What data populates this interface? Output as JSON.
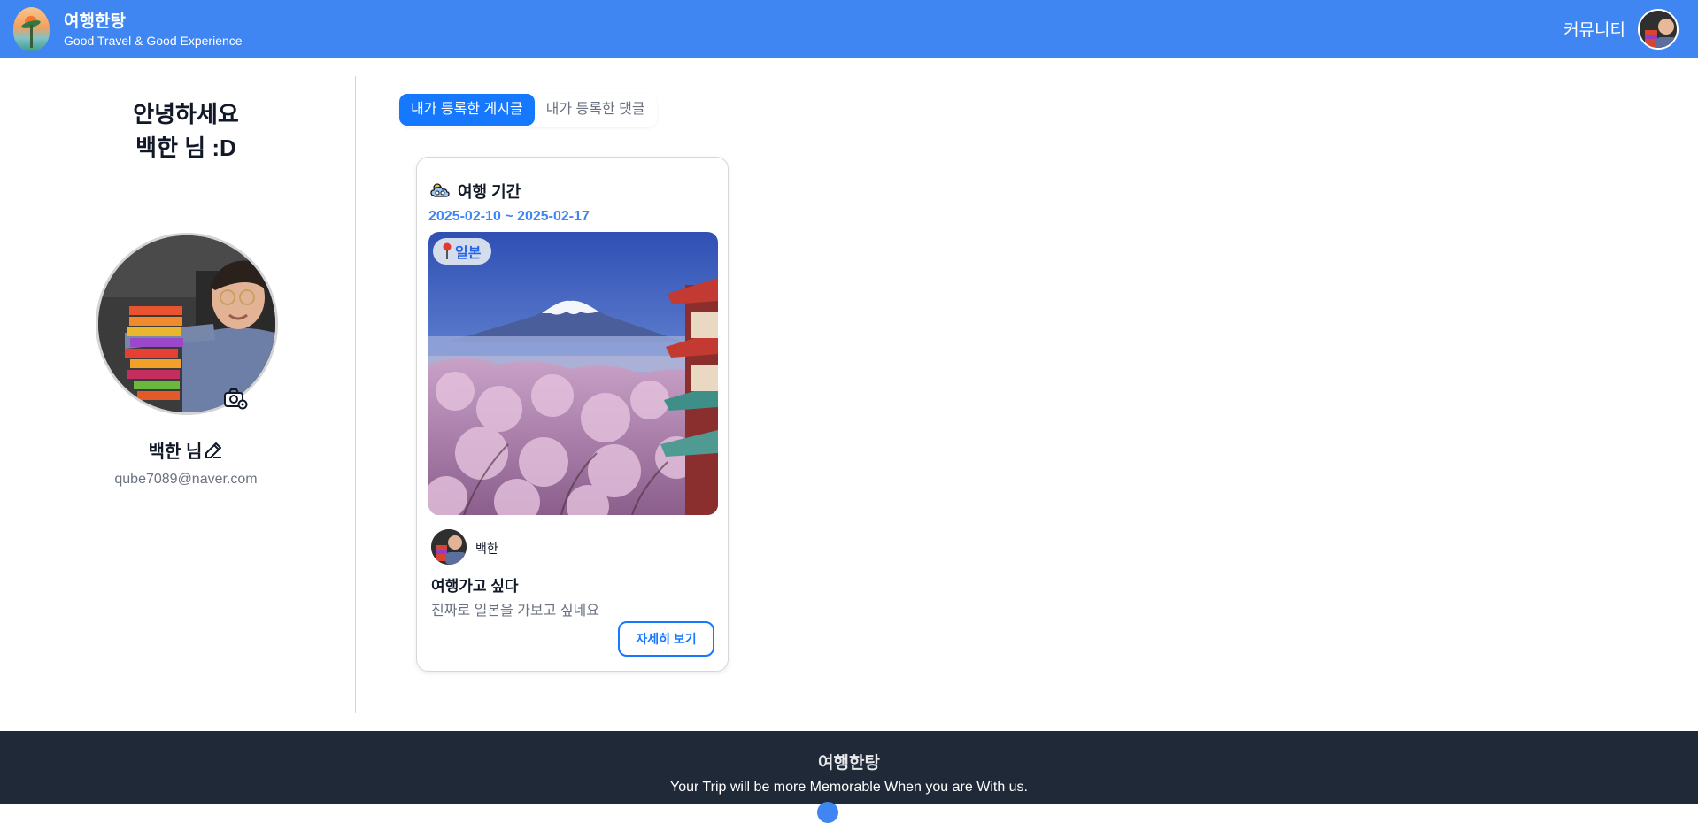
{
  "header": {
    "brand_title": "여행한탕",
    "brand_subtitle": "Good Travel & Good Experience",
    "nav_community": "커뮤니티",
    "accent_color": "#3f86f3"
  },
  "sidebar": {
    "greeting_line1": "안녕하세요",
    "greeting_line2": "백한 님 :D",
    "profile_name": "백한 님",
    "profile_email": "qube7089@naver.com",
    "icons": [
      "camera-icon",
      "edit-icon"
    ]
  },
  "tabs": [
    {
      "label": "내가 등록한 게시글",
      "active": true
    },
    {
      "label": "내가 등록한 댓글",
      "active": false
    }
  ],
  "post_card": {
    "period_title": "여행 기간",
    "dates": "2025-02-10 ~ 2025-02-17",
    "location": "일본",
    "author": "백한",
    "title": "여행가고 싶다",
    "body": "진짜로 일본을 가보고 싶네요",
    "detail_button": "자세히 보기",
    "icons": [
      "cloud-sun-icon",
      "map-pin-icon"
    ]
  },
  "footer": {
    "title": "여행한탕",
    "tagline": "Your Trip will be more Memorable When you are With us."
  }
}
